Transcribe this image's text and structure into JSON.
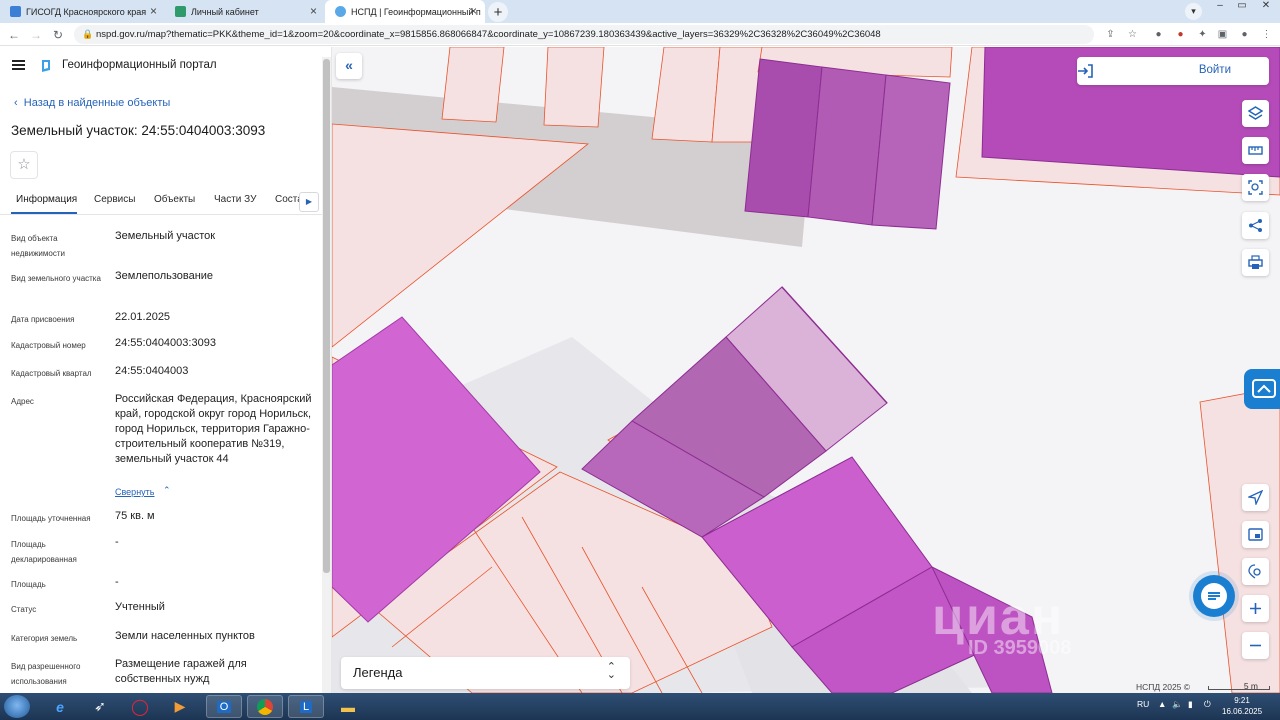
{
  "browser": {
    "tabs": [
      {
        "title": "ГИСОГД Красноярского края",
        "active": false
      },
      {
        "title": "Личный кабинет",
        "active": false
      },
      {
        "title": "НСПД | Геоинформационный п",
        "active": true
      }
    ],
    "url": "nspd.gov.ru/map?thematic=PKK&theme_id=1&zoom=20&coordinate_x=9815856.868066847&coordinate_y=10867239.180363439&active_layers=36329%2C36328%2C36049%2C36048"
  },
  "header": {
    "portal_title": "Геоинформационный портал"
  },
  "panel": {
    "back_link": "Назад в найденные объекты",
    "object_title": "Земельный участок: 24:55:0404003:3093",
    "favorite_icon": "☆",
    "tabs": [
      "Информация",
      "Сервисы",
      "Объекты",
      "Части ЗУ",
      "Соста"
    ],
    "fields": [
      {
        "label": "Вид объекта недвижимости",
        "value": "Земельный участок"
      },
      {
        "label": "Вид земельного участка",
        "value": "Землепользование"
      },
      {
        "label": "Дата присвоения",
        "value": "22.01.2025"
      },
      {
        "label": "Кадастровый номер",
        "value": "24:55:0404003:3093"
      },
      {
        "label": "Кадастровый квартал",
        "value": "24:55:0404003"
      },
      {
        "label": "Адрес",
        "value": "Российская Федерация, Красноярский край, городской округ город Норильск, город Норильск, территория Гаражно-строительный кооператив №319, земельный участок 44"
      },
      {
        "label": "Площадь уточненная",
        "value": "75 кв. м"
      },
      {
        "label": "Площадь декларированная",
        "value": "-"
      },
      {
        "label": "Площадь",
        "value": "-"
      },
      {
        "label": "Статус",
        "value": "Учтенный"
      },
      {
        "label": "Категория земель",
        "value": "Земли населенных пунктов"
      },
      {
        "label": "Вид разрешенного использования",
        "value": "Размещение гаражей для собственных нужд"
      }
    ],
    "collapse_link": "Свернуть"
  },
  "map": {
    "login_label": "Войти",
    "legend_label": "Легенда",
    "attribution": "НСПД 2025 ©",
    "scale_label": "5 m",
    "watermark": "циан",
    "watermark_id": "ID 3959008",
    "colors": {
      "parcel_fill": "#c04fc4",
      "parcel_stroke": "#e8532a",
      "selected": "#a33aa8",
      "accent": "#1a7fd1"
    }
  },
  "taskbar": {
    "lang": "RU",
    "time": "9:21",
    "date": "16.06.2025"
  }
}
